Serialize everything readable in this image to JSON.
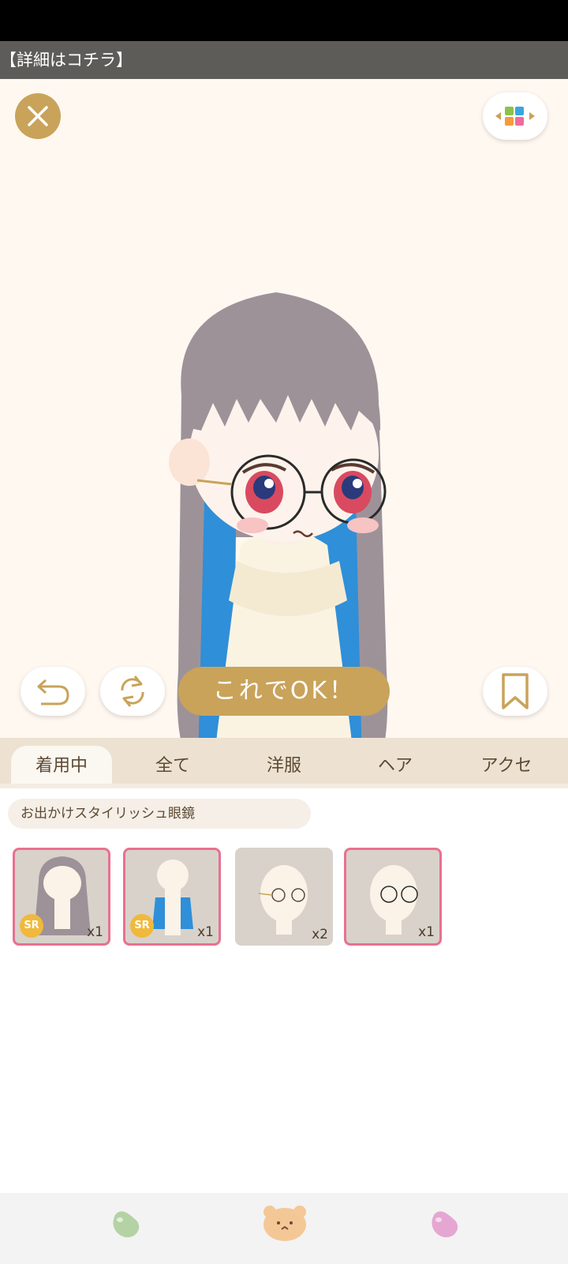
{
  "banner": {
    "text": "【詳細はコチラ】"
  },
  "actions": {
    "ok_label": "これでOK！"
  },
  "tabs": [
    {
      "label": "着用中"
    },
    {
      "label": "全て"
    },
    {
      "label": "洋服"
    },
    {
      "label": "ヘア"
    },
    {
      "label": "アクセ"
    }
  ],
  "item_name": "お出かけスタイリッシュ眼鏡",
  "items": [
    {
      "badge": "SR",
      "count": "x1"
    },
    {
      "badge": "SR",
      "count": "x1"
    },
    {
      "count": "x2"
    },
    {
      "count": "x1"
    }
  ],
  "colors": {
    "accent": "#c9a35a",
    "selected_border": "#e8718f",
    "tab_bar": "#ede2d1",
    "stage": "#fff8f1"
  }
}
